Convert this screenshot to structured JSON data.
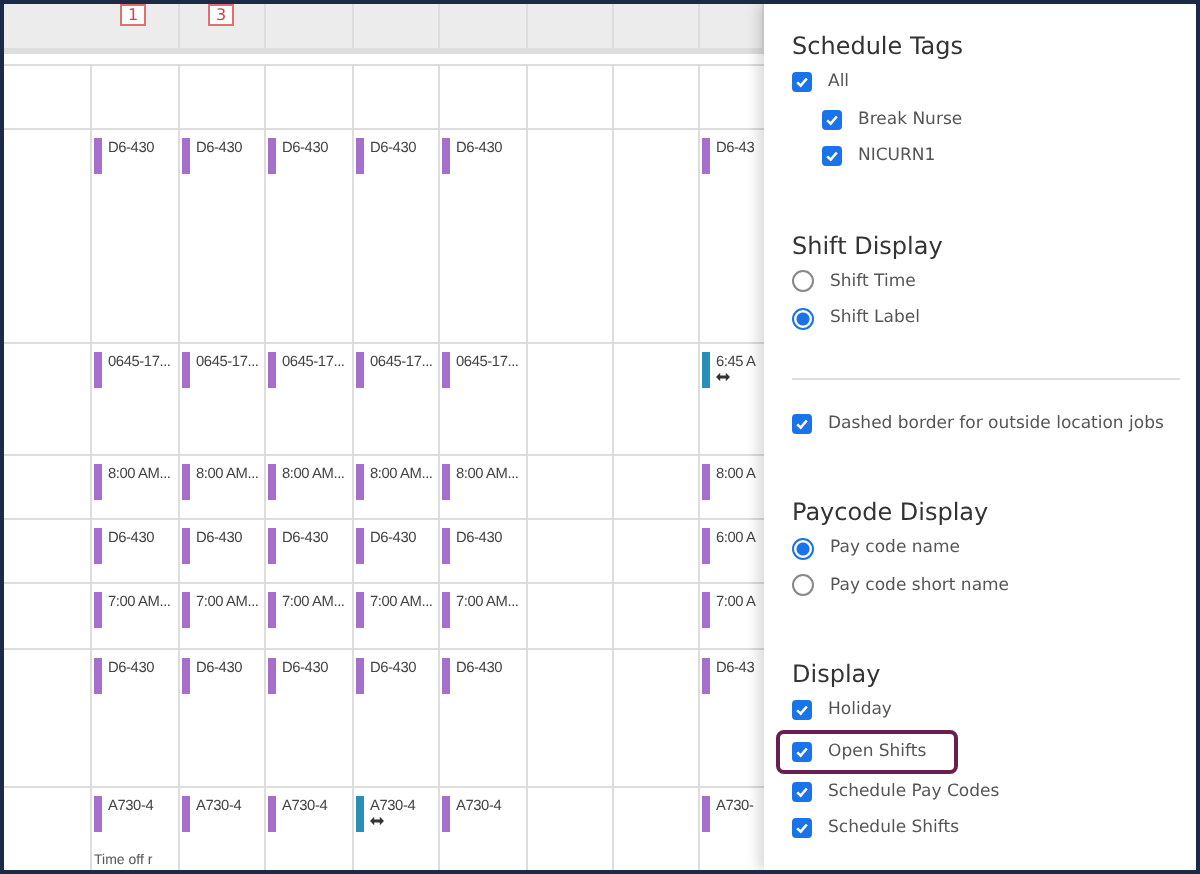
{
  "header": {
    "badges": [
      "1",
      "3"
    ]
  },
  "rows": [
    {
      "cells": [
        null,
        null,
        null,
        null,
        null,
        null,
        null,
        null
      ]
    },
    {
      "cells": [
        {
          "text": "D6-430",
          "color": "#a66fcb",
          "swap": false
        },
        {
          "text": "D6-430",
          "color": "#a66fcb",
          "swap": false
        },
        {
          "text": "D6-430",
          "color": "#a66fcb",
          "swap": false
        },
        {
          "text": "D6-430",
          "color": "#a66fcb",
          "swap": false
        },
        {
          "text": "D6-430",
          "color": "#a66fcb",
          "swap": false
        },
        null,
        null,
        {
          "text": "D6-43",
          "color": "#a66fcb",
          "swap": false
        }
      ]
    },
    {
      "cells": [
        {
          "text": "0645-17...",
          "color": "#a66fcb",
          "swap": false
        },
        {
          "text": "0645-17...",
          "color": "#a66fcb",
          "swap": false
        },
        {
          "text": "0645-17...",
          "color": "#a66fcb",
          "swap": false
        },
        {
          "text": "0645-17...",
          "color": "#a66fcb",
          "swap": false
        },
        {
          "text": "0645-17...",
          "color": "#a66fcb",
          "swap": false
        },
        null,
        null,
        {
          "text": "6:45 A",
          "color": "#2a8fb6",
          "swap": true
        }
      ]
    },
    {
      "cells": [
        {
          "text": "8:00 AM...",
          "color": "#a66fcb",
          "swap": false
        },
        {
          "text": "8:00 AM...",
          "color": "#a66fcb",
          "swap": false
        },
        {
          "text": "8:00 AM...",
          "color": "#a66fcb",
          "swap": false
        },
        {
          "text": "8:00 AM...",
          "color": "#a66fcb",
          "swap": false
        },
        {
          "text": "8:00 AM...",
          "color": "#a66fcb",
          "swap": false
        },
        null,
        null,
        {
          "text": "8:00 A",
          "color": "#a66fcb",
          "swap": false
        }
      ]
    },
    {
      "cells": [
        {
          "text": "D6-430",
          "color": "#a66fcb",
          "swap": false
        },
        {
          "text": "D6-430",
          "color": "#a66fcb",
          "swap": false
        },
        {
          "text": "D6-430",
          "color": "#a66fcb",
          "swap": false
        },
        {
          "text": "D6-430",
          "color": "#a66fcb",
          "swap": false
        },
        {
          "text": "D6-430",
          "color": "#a66fcb",
          "swap": false
        },
        null,
        null,
        {
          "text": "6:00 A",
          "color": "#a66fcb",
          "swap": false
        }
      ]
    },
    {
      "cells": [
        {
          "text": "7:00 AM...",
          "color": "#a66fcb",
          "swap": false
        },
        {
          "text": "7:00 AM...",
          "color": "#a66fcb",
          "swap": false
        },
        {
          "text": "7:00 AM...",
          "color": "#a66fcb",
          "swap": false
        },
        {
          "text": "7:00 AM...",
          "color": "#a66fcb",
          "swap": false
        },
        {
          "text": "7:00 AM...",
          "color": "#a66fcb",
          "swap": false
        },
        null,
        null,
        {
          "text": "7:00 A",
          "color": "#a66fcb",
          "swap": false
        }
      ]
    },
    {
      "cells": [
        {
          "text": "D6-430",
          "color": "#a66fcb",
          "swap": false
        },
        {
          "text": "D6-430",
          "color": "#a66fcb",
          "swap": false
        },
        {
          "text": "D6-430",
          "color": "#a66fcb",
          "swap": false
        },
        {
          "text": "D6-430",
          "color": "#a66fcb",
          "swap": false
        },
        {
          "text": "D6-430",
          "color": "#a66fcb",
          "swap": false
        },
        null,
        null,
        {
          "text": "D6-43",
          "color": "#a66fcb",
          "swap": false
        }
      ]
    },
    {
      "cells": [
        {
          "text": "A730-4",
          "color": "#a66fcb",
          "swap": false,
          "note": "Time off r"
        },
        {
          "text": "A730-4",
          "color": "#a66fcb",
          "swap": false
        },
        {
          "text": "A730-4",
          "color": "#a66fcb",
          "swap": false
        },
        {
          "text": "A730-4",
          "color": "#2a8fb6",
          "swap": true
        },
        {
          "text": "A730-4",
          "color": "#a66fcb",
          "swap": false
        },
        null,
        null,
        {
          "text": "A730-",
          "color": "#a66fcb",
          "swap": false
        }
      ]
    }
  ],
  "panel": {
    "sections": [
      {
        "title": "Schedule Tags",
        "items": [
          {
            "kind": "checkbox",
            "label": "All",
            "checked": true,
            "highlighted": false,
            "children": [
              {
                "kind": "checkbox",
                "label": "Break Nurse",
                "checked": true
              },
              {
                "kind": "checkbox",
                "label": "NICURN1",
                "checked": true
              }
            ]
          }
        ]
      },
      {
        "title": "Shift Display",
        "items": [
          {
            "kind": "radio",
            "label": "Shift Time",
            "selected": false,
            "highlighted": false
          },
          {
            "kind": "radio",
            "label": "Shift Label",
            "selected": true,
            "highlighted": false
          }
        ]
      },
      {
        "items": [
          {
            "kind": "checkbox",
            "label": "Dashed border for outside location jobs",
            "checked": true,
            "highlighted": false
          }
        ]
      },
      {
        "title": "Paycode Display",
        "items": [
          {
            "kind": "radio",
            "label": "Pay code name",
            "selected": true,
            "highlighted": false
          },
          {
            "kind": "radio",
            "label": "Pay code short name",
            "selected": false,
            "highlighted": false
          }
        ]
      },
      {
        "title": "Display",
        "items": [
          {
            "kind": "checkbox",
            "label": "Holiday",
            "checked": true,
            "highlighted": false
          },
          {
            "kind": "checkbox",
            "label": "Open Shifts",
            "checked": true,
            "highlighted": true
          },
          {
            "kind": "checkbox",
            "label": "Schedule Pay Codes",
            "checked": true,
            "highlighted": false
          },
          {
            "kind": "checkbox",
            "label": "Schedule Shifts",
            "checked": true,
            "highlighted": false
          }
        ]
      }
    ]
  }
}
